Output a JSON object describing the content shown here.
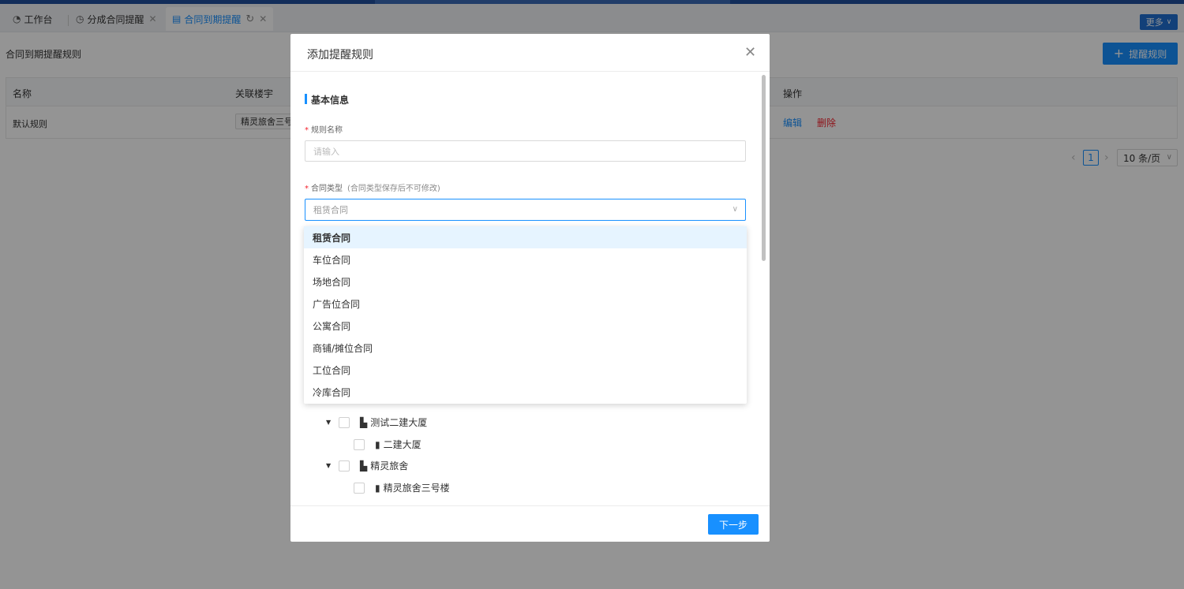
{
  "tabs": [
    {
      "icon": "dashboard-icon",
      "label": "工作台"
    },
    {
      "icon": "clock-icon",
      "label": "分成合同提醒"
    },
    {
      "icon": "document-icon",
      "label": "合同到期提醒",
      "active": true
    }
  ],
  "more_label": "更多",
  "page": {
    "title": "合同到期提醒规则",
    "add_button": "提醒规则"
  },
  "table": {
    "columns": [
      "名称",
      "关联楼宇",
      "操作"
    ],
    "rows": [
      {
        "name": "默认规则",
        "building": "精灵旅舍三号",
        "edit": "编辑",
        "delete": "删除"
      }
    ]
  },
  "pagination": {
    "current": "1",
    "page_size": "10 条/页"
  },
  "modal": {
    "title": "添加提醒规则",
    "section": "基本信息",
    "rule_name_label": "规则名称",
    "rule_name_placeholder": "请输入",
    "contract_type_label": "合同类型",
    "contract_type_hint": "(合同类型保存后不可修改)",
    "contract_type_value": "租赁合同",
    "next_button": "下一步",
    "tree": [
      {
        "label": "测试二建大厦",
        "level": 0,
        "expanded": true
      },
      {
        "label": "二建大厦",
        "level": 1
      },
      {
        "label": "精灵旅舍",
        "level": 0,
        "expanded": true
      },
      {
        "label": "精灵旅舍三号楼",
        "level": 1
      }
    ]
  },
  "dropdown": {
    "options": [
      "租赁合同",
      "车位合同",
      "场地合同",
      "广告位合同",
      "公寓合同",
      "商铺/摊位合同",
      "工位合同",
      "冷库合同"
    ],
    "selected_index": 0
  },
  "colors": {
    "primary": "#1890ff",
    "danger": "#f5222d",
    "header": "#1f4e9c"
  }
}
